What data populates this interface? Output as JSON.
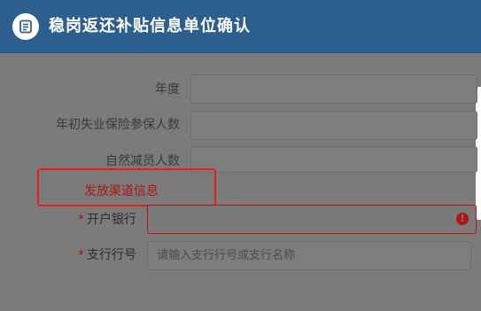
{
  "header": {
    "title": "稳岗返还补贴信息单位确认",
    "icon": "list-icon"
  },
  "form": {
    "fields": [
      {
        "label": "年度",
        "value": ""
      },
      {
        "label": "年初失业保险参保人数",
        "value": ""
      },
      {
        "label": "自然减员人数",
        "value": ""
      }
    ],
    "section_title": "发放渠道信息",
    "required_mark": "*",
    "bank": {
      "label": "开户银行",
      "value": "",
      "error_icon": "!"
    },
    "branch": {
      "label": "支行行号",
      "placeholder": "请输入支行行号或支行名称",
      "value": ""
    }
  },
  "colors": {
    "header_bg": "#2c5f8e",
    "overlay_bg": "#7b7b7b",
    "section_title": "#b01414",
    "highlight_box": "#ec1c1c",
    "error": "#b01414"
  }
}
